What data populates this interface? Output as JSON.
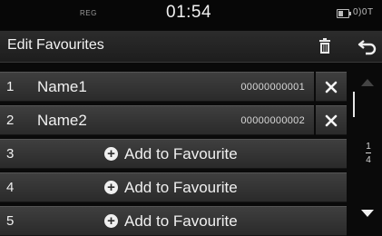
{
  "status": {
    "reg_label": "REG",
    "time": "01:54",
    "indicators": "0)0T"
  },
  "header": {
    "title": "Edit Favourites",
    "delete_icon": "trash-icon",
    "back_icon": "back-arrow-icon"
  },
  "favourites": [
    {
      "index": "1",
      "name": "Name1",
      "phone": "00000000001"
    },
    {
      "index": "2",
      "name": "Name2",
      "phone": "00000000002"
    }
  ],
  "empty_slots": [
    {
      "index": "3",
      "label": "Add to Favourite"
    },
    {
      "index": "4",
      "label": "Add to Favourite"
    },
    {
      "index": "5",
      "label": "Add to Favourite"
    }
  ],
  "scroll": {
    "page_current": "1",
    "page_total": "4"
  }
}
